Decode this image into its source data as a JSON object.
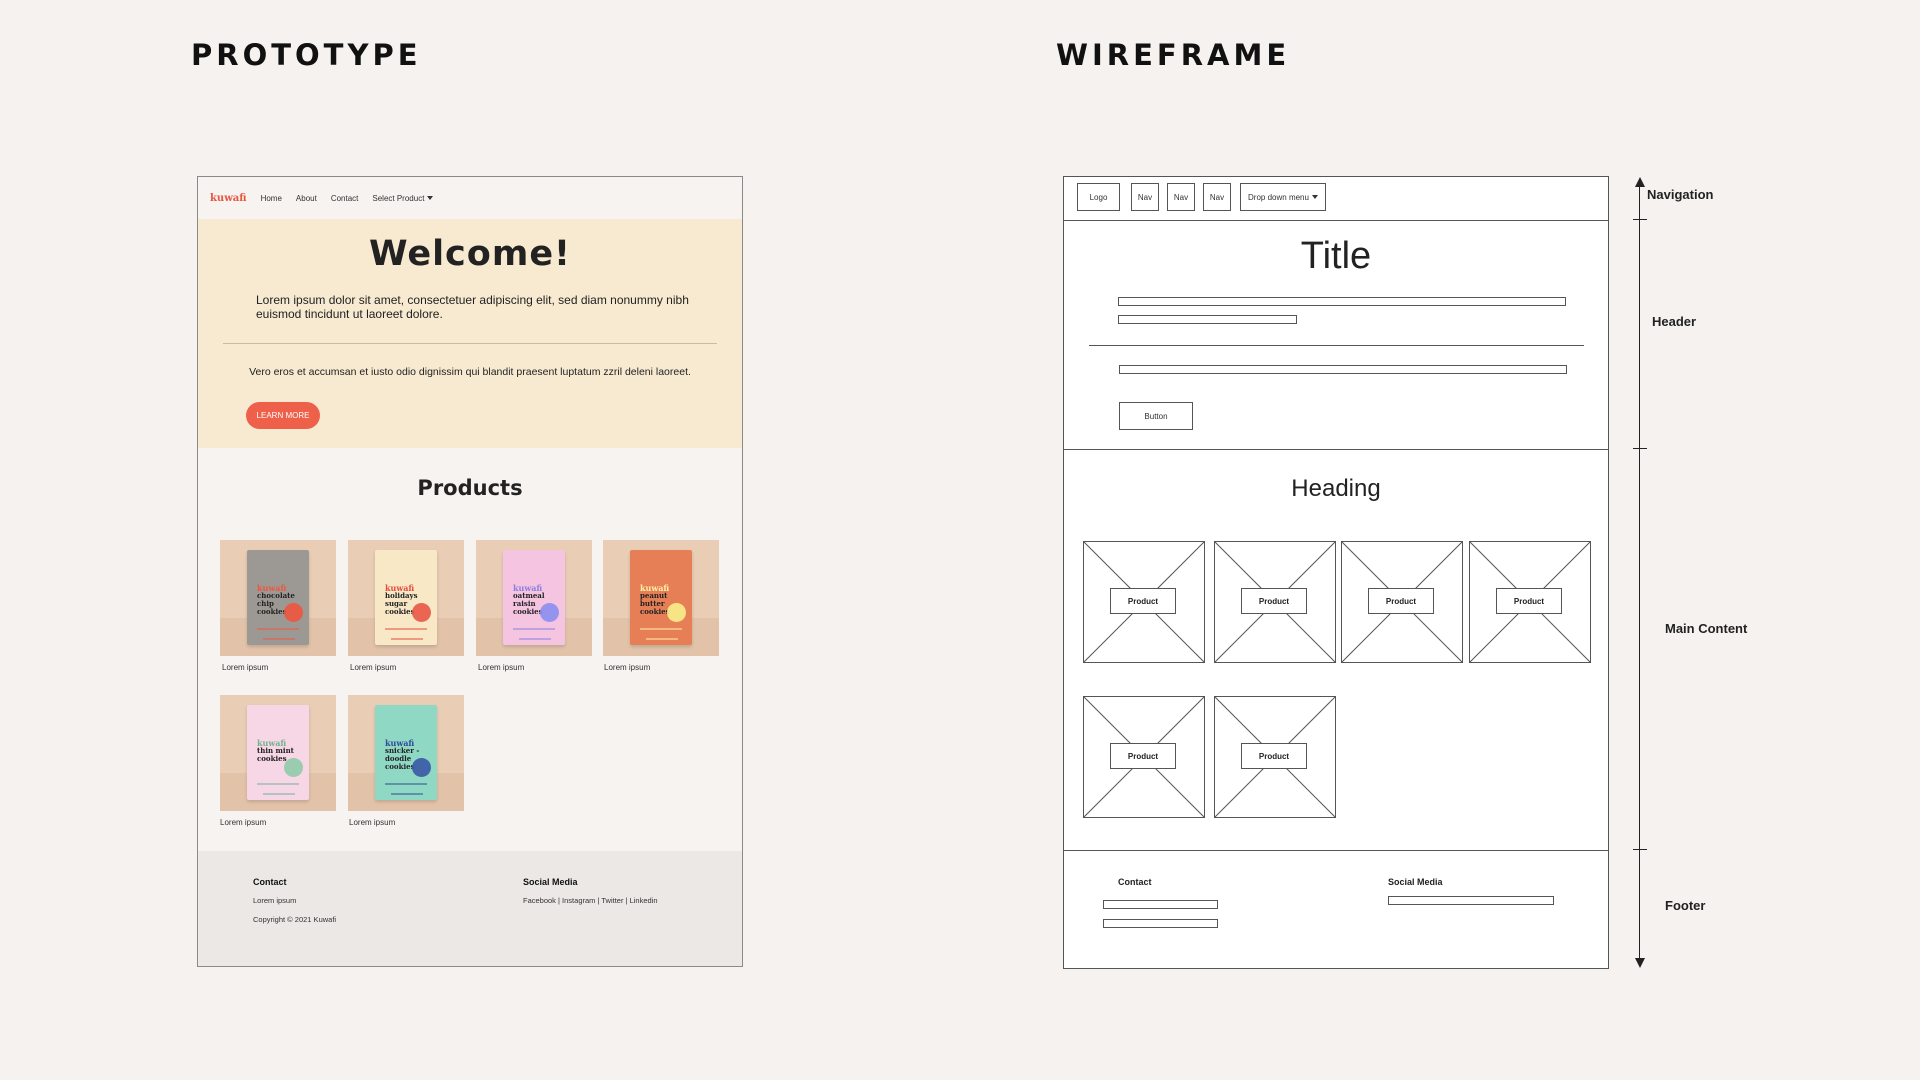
{
  "headings": {
    "prototype": "PROTOTYPE",
    "wireframe": "WIREFRAME"
  },
  "prototype": {
    "logo": "kuwafi",
    "nav": [
      "Home",
      "About",
      "Contact",
      "Select Product"
    ],
    "hero": {
      "title": "Welcome!",
      "lead": "Lorem ipsum dolor sit amet, consectetuer adipiscing elit, sed diam nonummy nibh euismod tincidunt ut laoreet dolore.",
      "sub": "Vero eros et accumsan et iusto odio dignissim qui blandit praesent luptatum zzril deleni laoreet.",
      "button": "LEARN MORE"
    },
    "products_heading": "Products",
    "products": [
      {
        "brand": "kuwafi",
        "name": "chocolate chip cookies",
        "caption": "Lorem ipsum",
        "box_color": "#9c9994",
        "dot_color": "#ef553e",
        "brand_color": "#ef553e"
      },
      {
        "brand": "kuwafi",
        "name": "holidays sugar cookies",
        "caption": "Lorem ipsum",
        "box_color": "#f8e8c6",
        "dot_color": "#e85846",
        "brand_color": "#e84a3e"
      },
      {
        "brand": "kuwafi",
        "name": "oatmeal raisin cookies",
        "caption": "Lorem ipsum",
        "box_color": "#f5c4e0",
        "dot_color": "#8c8ef0",
        "brand_color": "#8c7ee0"
      },
      {
        "brand": "kuwafi",
        "name": "peanut butter cookies",
        "caption": "Lorem ipsum",
        "box_color": "#e67f56",
        "dot_color": "#f8f08a",
        "brand_color": "#fff2a6"
      },
      {
        "brand": "kuwafi",
        "name": "thin mint cookies",
        "caption": "Lorem ipsum",
        "box_color": "#f7d6e6",
        "dot_color": "#8fcba8",
        "brand_color": "#6fb48e"
      },
      {
        "brand": "kuwafi",
        "name": "snicker -doodle cookies",
        "caption": "Lorem ipsum",
        "box_color": "#8fd8c4",
        "dot_color": "#3a58a6",
        "brand_color": "#2f4a96"
      }
    ],
    "footer": {
      "contact_heading": "Contact",
      "contact_text": "Lorem ipsum",
      "copyright": "Copyright © 2021 Kuwafi",
      "social_heading": "Social Media",
      "social_links": "Facebook | Instagram | Twitter | Linkedin"
    }
  },
  "wireframe": {
    "nav": [
      "Logo",
      "Nav",
      "Nav",
      "Nav",
      "Drop down menu"
    ],
    "title": "Title",
    "button": "Button",
    "heading": "Heading",
    "product_label": "Product",
    "footer": {
      "contact": "Contact",
      "social": "Social Media"
    }
  },
  "annotations": [
    "Navigation",
    "Header",
    "Main Content",
    "Footer"
  ],
  "colors": {
    "accent": "#ef604a",
    "hero_bg": "#f8ead1",
    "page_bg": "#f6f2ef",
    "footer_bg": "#ebe8e6"
  }
}
